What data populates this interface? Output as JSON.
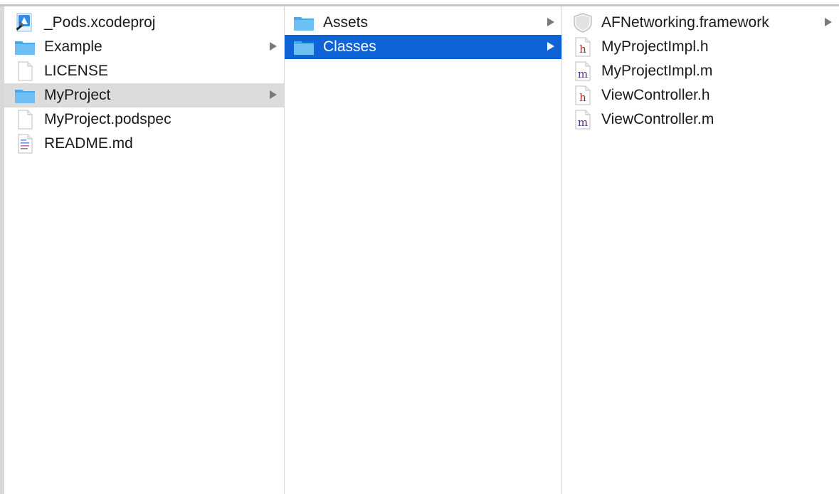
{
  "columns": [
    {
      "items": [
        {
          "label": "_Pods.xcodeproj",
          "icon": "xcodeproj-icon",
          "chevron": false,
          "selected": "none"
        },
        {
          "label": "Example",
          "icon": "folder-icon",
          "chevron": true,
          "selected": "none"
        },
        {
          "label": "LICENSE",
          "icon": "document-icon",
          "chevron": false,
          "selected": "none"
        },
        {
          "label": "MyProject",
          "icon": "folder-icon",
          "chevron": true,
          "selected": "inactive"
        },
        {
          "label": "MyProject.podspec",
          "icon": "document-icon",
          "chevron": false,
          "selected": "none"
        },
        {
          "label": "README.md",
          "icon": "text-document-icon",
          "chevron": false,
          "selected": "none"
        }
      ]
    },
    {
      "items": [
        {
          "label": "Assets",
          "icon": "folder-icon",
          "chevron": true,
          "selected": "none"
        },
        {
          "label": "Classes",
          "icon": "folder-icon",
          "chevron": true,
          "selected": "active"
        }
      ]
    },
    {
      "items": [
        {
          "label": "AFNetworking.framework",
          "icon": "framework-icon",
          "chevron": true,
          "selected": "none"
        },
        {
          "label": "MyProjectImpl.h",
          "icon": "header-file-icon",
          "chevron": false,
          "selected": "none",
          "badge": "h"
        },
        {
          "label": "MyProjectImpl.m",
          "icon": "implementation-file-icon",
          "chevron": false,
          "selected": "none",
          "badge": "m"
        },
        {
          "label": "ViewController.h",
          "icon": "header-file-icon",
          "chevron": false,
          "selected": "none",
          "badge": "h"
        },
        {
          "label": "ViewController.m",
          "icon": "implementation-file-icon",
          "chevron": false,
          "selected": "none",
          "badge": "m"
        }
      ]
    }
  ],
  "colors": {
    "selection_active": "#0f63d6",
    "selection_inactive": "#dcdcdc",
    "folder": "#5fb4f0",
    "header_badge": "#9c2a2a",
    "impl_badge": "#5a2a8c"
  }
}
